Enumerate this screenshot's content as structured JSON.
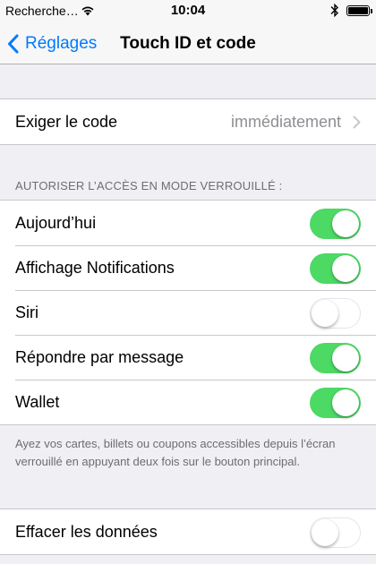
{
  "status_bar": {
    "carrier": "Recherche…",
    "time": "10:04",
    "battery_level": 1.0
  },
  "nav": {
    "back_label": "Réglages",
    "title": "Touch ID et code"
  },
  "code_row": {
    "label": "Exiger le code",
    "value": "immédiatement"
  },
  "lock_section": {
    "header": "AUTORISER L’ACCÈS EN MODE VERROUILLÉ :",
    "items": [
      {
        "label": "Aujourd’hui",
        "on": true
      },
      {
        "label": "Affichage Notifications",
        "on": true
      },
      {
        "label": "Siri",
        "on": false
      },
      {
        "label": "Répondre par message",
        "on": true
      },
      {
        "label": "Wallet",
        "on": true
      }
    ],
    "footer": "Ayez vos cartes, billets ou coupons accessibles depuis l’écran verrouillé en appuyant deux fois sur le bouton principal."
  },
  "erase_row": {
    "label": "Effacer les données",
    "on": false
  },
  "colors": {
    "accent": "#007aff",
    "toggle_on": "#4cd964",
    "background": "#efeff4"
  },
  "icons": [
    "wifi-icon",
    "bluetooth-icon",
    "battery-icon",
    "back-chevron-icon",
    "chevron-right-icon"
  ]
}
